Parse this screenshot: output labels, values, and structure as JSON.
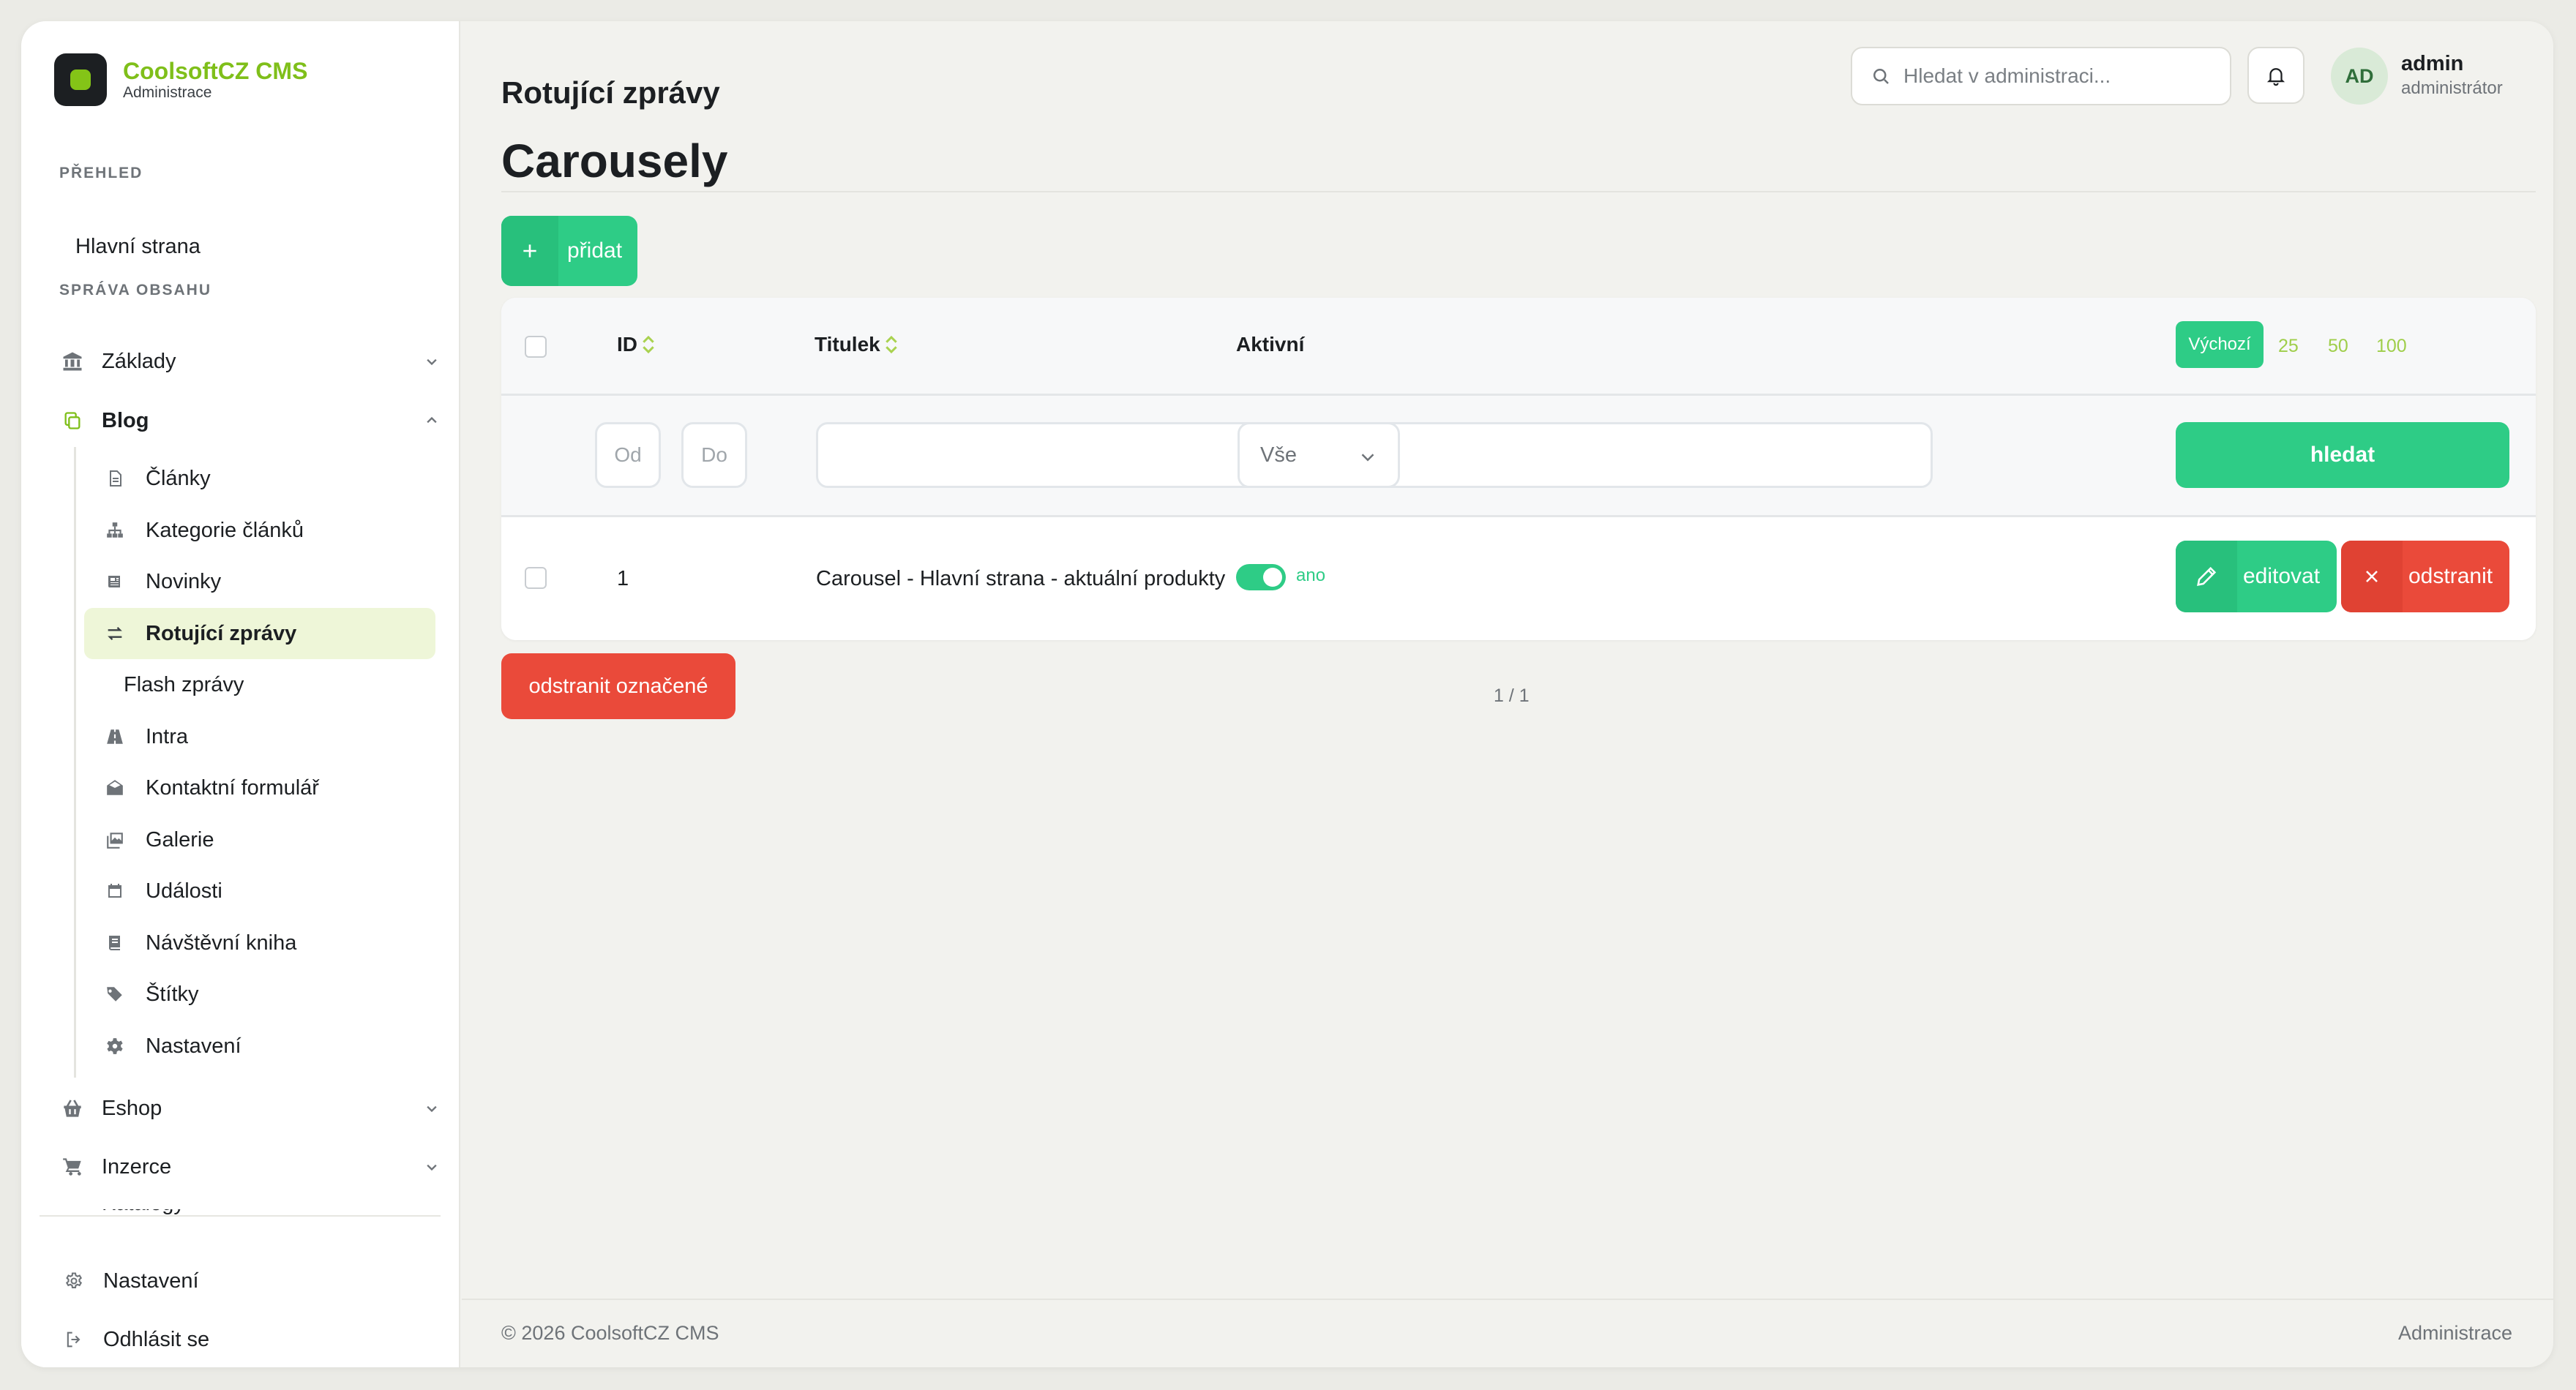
{
  "brand": {
    "name": "CoolsoftCZ CMS",
    "subtitle": "Administrace"
  },
  "colors": {
    "accent": "#2ecc86",
    "brand_green": "#7fbf1a",
    "danger": "#ea4a3a",
    "active_bg": "#eef6d8"
  },
  "sidebar": {
    "sections": [
      {
        "label": "PŘEHLED"
      },
      {
        "label": "SPRÁVA OBSAHU"
      }
    ],
    "dashboard": {
      "label": "Hlavní strana"
    },
    "groups": [
      {
        "label": "Základy",
        "icon": "bank-icon",
        "expanded": false
      },
      {
        "label": "Blog",
        "icon": "copy-icon",
        "expanded": true
      },
      {
        "label": "Eshop",
        "icon": "basket-icon",
        "expanded": false
      },
      {
        "label": "Inzerce",
        "icon": "cart-icon",
        "expanded": false
      },
      {
        "label": "Katalogy",
        "icon": "list-icon",
        "expanded": false
      }
    ],
    "blog_items": [
      {
        "label": "Články",
        "icon": "file-icon"
      },
      {
        "label": "Kategorie článků",
        "icon": "sitemap-icon"
      },
      {
        "label": "Novinky",
        "icon": "newspaper-icon"
      },
      {
        "label": "Rotující zprávy",
        "icon": "arrows-exchange-icon",
        "active": true
      },
      {
        "label": "Flash zprávy",
        "icon": ""
      },
      {
        "label": "Intra",
        "icon": "road-icon"
      },
      {
        "label": "Kontaktní formulář",
        "icon": "envelope-open-icon"
      },
      {
        "label": "Galerie",
        "icon": "images-icon"
      },
      {
        "label": "Události",
        "icon": "calendar-icon"
      },
      {
        "label": "Návštěvní kniha",
        "icon": "book-icon"
      },
      {
        "label": "Štítky",
        "icon": "tags-icon"
      },
      {
        "label": "Nastavení",
        "icon": "cog-icon"
      }
    ],
    "bottom": [
      {
        "label": "Nastavení",
        "icon": "gear-icon"
      },
      {
        "label": "Odhlásit se",
        "icon": "logout-icon"
      }
    ]
  },
  "header": {
    "title": "Rotující zprávy",
    "search_placeholder": "Hledat v administraci...",
    "user": {
      "initials": "AD",
      "name": "admin",
      "role": "administrátor"
    }
  },
  "main": {
    "heading": "Carousely",
    "add_label": "přidat",
    "table": {
      "columns": {
        "id": "ID",
        "title": "Titulek",
        "active": "Aktivní"
      },
      "per_page": {
        "selected": "Výchozí",
        "options": [
          "25",
          "50",
          "100"
        ]
      },
      "filters": {
        "id_from_placeholder": "Od",
        "id_to_placeholder": "Do",
        "title_value": "",
        "active_value": "Vše",
        "search_label": "hledat"
      },
      "rows": [
        {
          "id": "1",
          "title": "Carousel - Hlavní strana - aktuální produkty",
          "active": true,
          "active_label": "ano",
          "edit_label": "editovat",
          "delete_label": "odstranit"
        }
      ]
    },
    "bulk_delete_label": "odstranit označené",
    "pagination": "1 / 1"
  },
  "footer": {
    "copyright": "© 2026 CoolsoftCZ CMS",
    "right": "Administrace"
  }
}
